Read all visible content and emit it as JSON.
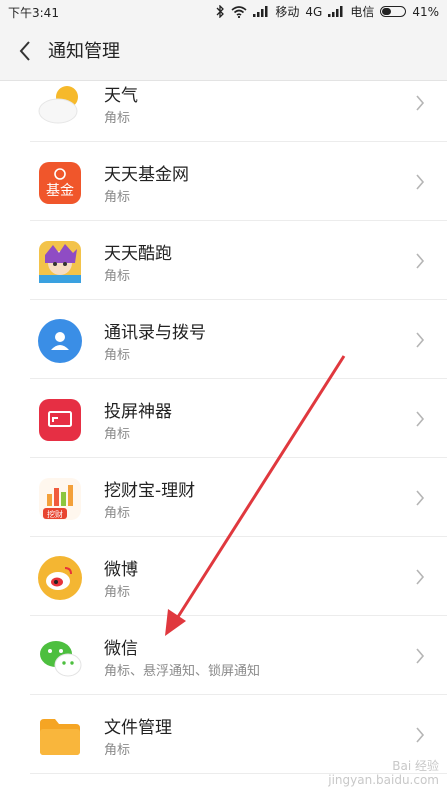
{
  "status_bar": {
    "time": "下午3:41",
    "carrier1": "移动",
    "network": "4G",
    "carrier2": "电信",
    "battery": "41%",
    "battery_level": 0.41
  },
  "header": {
    "title": "通知管理"
  },
  "apps": [
    {
      "name": "天气",
      "sub": "角标",
      "icon": "weather-icon"
    },
    {
      "name": "天天基金网",
      "sub": "角标",
      "icon": "fund-icon",
      "icon_text": "基金"
    },
    {
      "name": "天天酷跑",
      "sub": "角标",
      "icon": "parkour-game-icon"
    },
    {
      "name": "通讯录与拨号",
      "sub": "角标",
      "icon": "contacts-icon"
    },
    {
      "name": "投屏神器",
      "sub": "角标",
      "icon": "screen-cast-icon"
    },
    {
      "name": "挖财宝-理财",
      "sub": "角标",
      "icon": "wacai-icon",
      "icon_text": "挖财"
    },
    {
      "name": "微博",
      "sub": "角标",
      "icon": "weibo-icon"
    },
    {
      "name": "微信",
      "sub": "角标、悬浮通知、锁屏通知",
      "icon": "wechat-icon"
    },
    {
      "name": "文件管理",
      "sub": "角标",
      "icon": "folder-icon"
    }
  ],
  "watermark": {
    "line1": "Bai 经验",
    "line2": "jingyan.baidu.com"
  },
  "colors": {
    "annotation_arrow": "#e0383e"
  }
}
